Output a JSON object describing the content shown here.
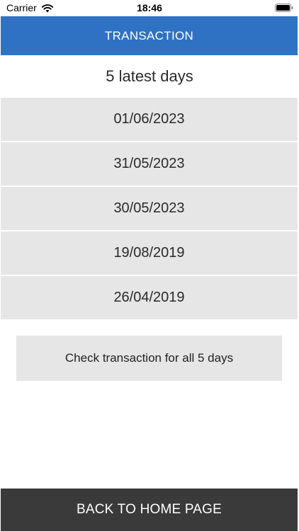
{
  "status_bar": {
    "carrier": "Carrier",
    "time": "18:46",
    "icons": [
      "wifi-icon",
      "battery-icon"
    ]
  },
  "header": {
    "title": "TRANSACTION",
    "color": "#2f72c4"
  },
  "subtitle": "5 latest days",
  "days": [
    {
      "label": "01/06/2023"
    },
    {
      "label": "31/05/2023"
    },
    {
      "label": "30/05/2023"
    },
    {
      "label": "19/08/2019"
    },
    {
      "label": "26/04/2019"
    }
  ],
  "check_button": {
    "label": "Check transaction for all 5 days"
  },
  "footer": {
    "label": "BACK TO HOME PAGE",
    "color": "#3a3a3a"
  }
}
